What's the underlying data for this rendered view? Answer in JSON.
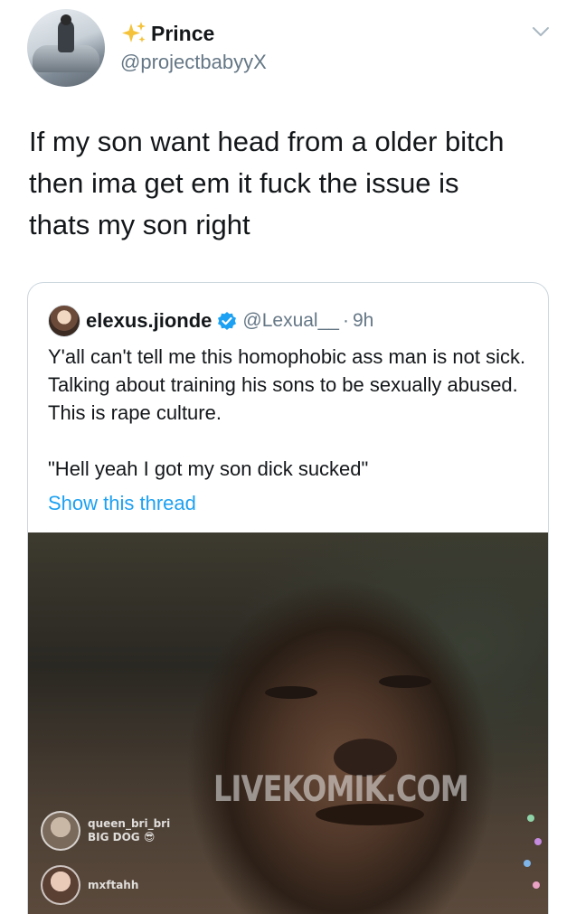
{
  "tweet": {
    "display_name": "Prince",
    "handle": "@projectbabyyX",
    "text": "If my son want head from a older bitch\nthen ima get em it fuck the issue is\nthats my son right"
  },
  "quote": {
    "display_name": "elexus.jionde",
    "handle": "@Lexual__",
    "separator": "·",
    "time": "9h",
    "paragraph1": "Y'all can't tell me this homophobic ass man is not sick. Talking about training his sons to be sexually abused. This is rape culture.",
    "paragraph2": "\"Hell yeah I got my son dick sucked\"",
    "show_thread": "Show this thread"
  },
  "video": {
    "watermark": "LIVEKOMIK.COM",
    "comments": [
      {
        "user": "queen_bri_bri",
        "text": "BIG DOG 😎"
      },
      {
        "user": "mxftahh",
        "text": ""
      }
    ]
  },
  "colors": {
    "text": "#14171a",
    "secondary": "#657786",
    "link": "#1da1f2",
    "border": "#ccd6dd",
    "verified": "#1da1f2"
  },
  "icons": [
    "sparkles-icon",
    "chevron-down-icon",
    "verified-badge-icon"
  ]
}
